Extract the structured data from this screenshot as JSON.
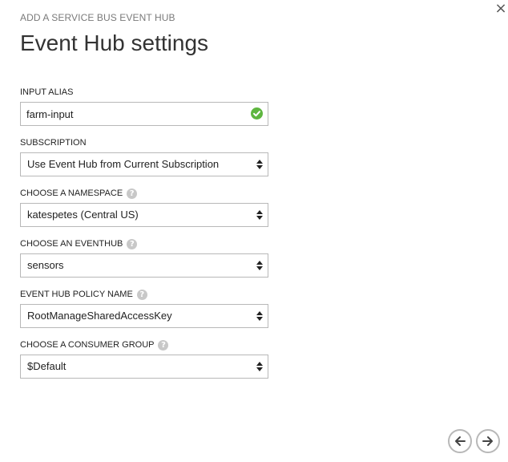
{
  "dialog": {
    "subtitle": "ADD A SERVICE BUS EVENT HUB",
    "title": "Event Hub settings",
    "close_glyph": "×"
  },
  "fields": {
    "input_alias": {
      "label": "INPUT ALIAS",
      "value": "farm-input",
      "status": "valid"
    },
    "subscription": {
      "label": "SUBSCRIPTION",
      "value": "Use Event Hub from Current Subscription"
    },
    "namespace": {
      "label": "CHOOSE A NAMESPACE",
      "value": "katespetes (Central US)"
    },
    "eventhub": {
      "label": "CHOOSE AN EVENTHUB",
      "value": "sensors"
    },
    "policy": {
      "label": "EVENT HUB POLICY NAME",
      "value": "RootManageSharedAccessKey"
    },
    "consumer_group": {
      "label": "CHOOSE A CONSUMER GROUP",
      "value": "$Default"
    }
  },
  "help_glyph": "?",
  "icons": {
    "close": "close-icon",
    "valid": "checkmark-icon",
    "help": "help-icon",
    "select": "select-arrows-icon",
    "back": "arrow-left-icon",
    "next": "arrow-right-icon"
  },
  "colors": {
    "valid": "#5eb63f",
    "help": "#c8c8c8",
    "border": "#b8b8b8"
  }
}
